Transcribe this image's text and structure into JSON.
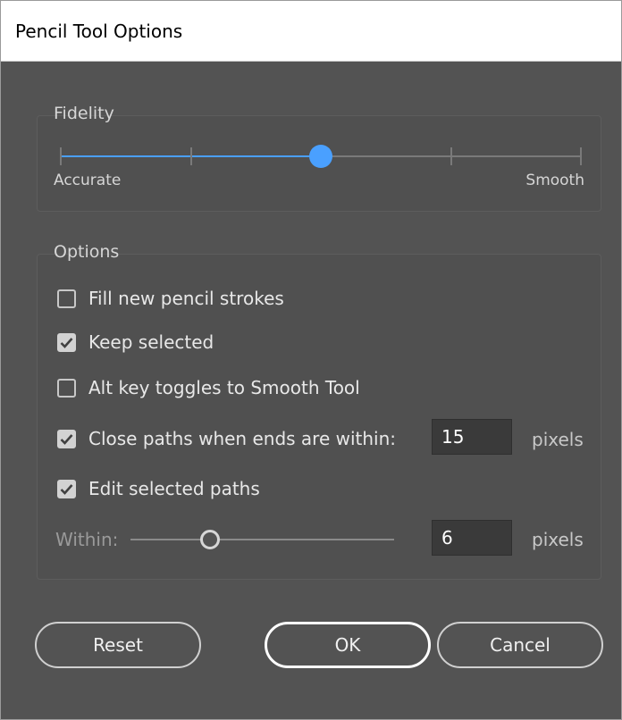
{
  "window": {
    "title": "Pencil Tool Options"
  },
  "fidelity": {
    "title": "Fidelity",
    "min_label": "Accurate",
    "max_label": "Smooth",
    "steps": 5,
    "value_step": 2,
    "accent": "#4aa0ff"
  },
  "options": {
    "title": "Options",
    "items": [
      {
        "label": "Fill new pencil strokes",
        "checked": false
      },
      {
        "label": "Keep selected",
        "checked": true
      },
      {
        "label": "Alt key toggles to Smooth Tool",
        "checked": false
      },
      {
        "label": "Close paths when ends are within:",
        "checked": true
      },
      {
        "label": "Edit selected paths",
        "checked": true
      }
    ],
    "close_paths_value": "15",
    "unit": "pixels",
    "within_label": "Within:",
    "within_value": "6",
    "within_slider_fraction": 0.3
  },
  "buttons": {
    "reset": "Reset",
    "ok": "OK",
    "cancel": "Cancel"
  }
}
